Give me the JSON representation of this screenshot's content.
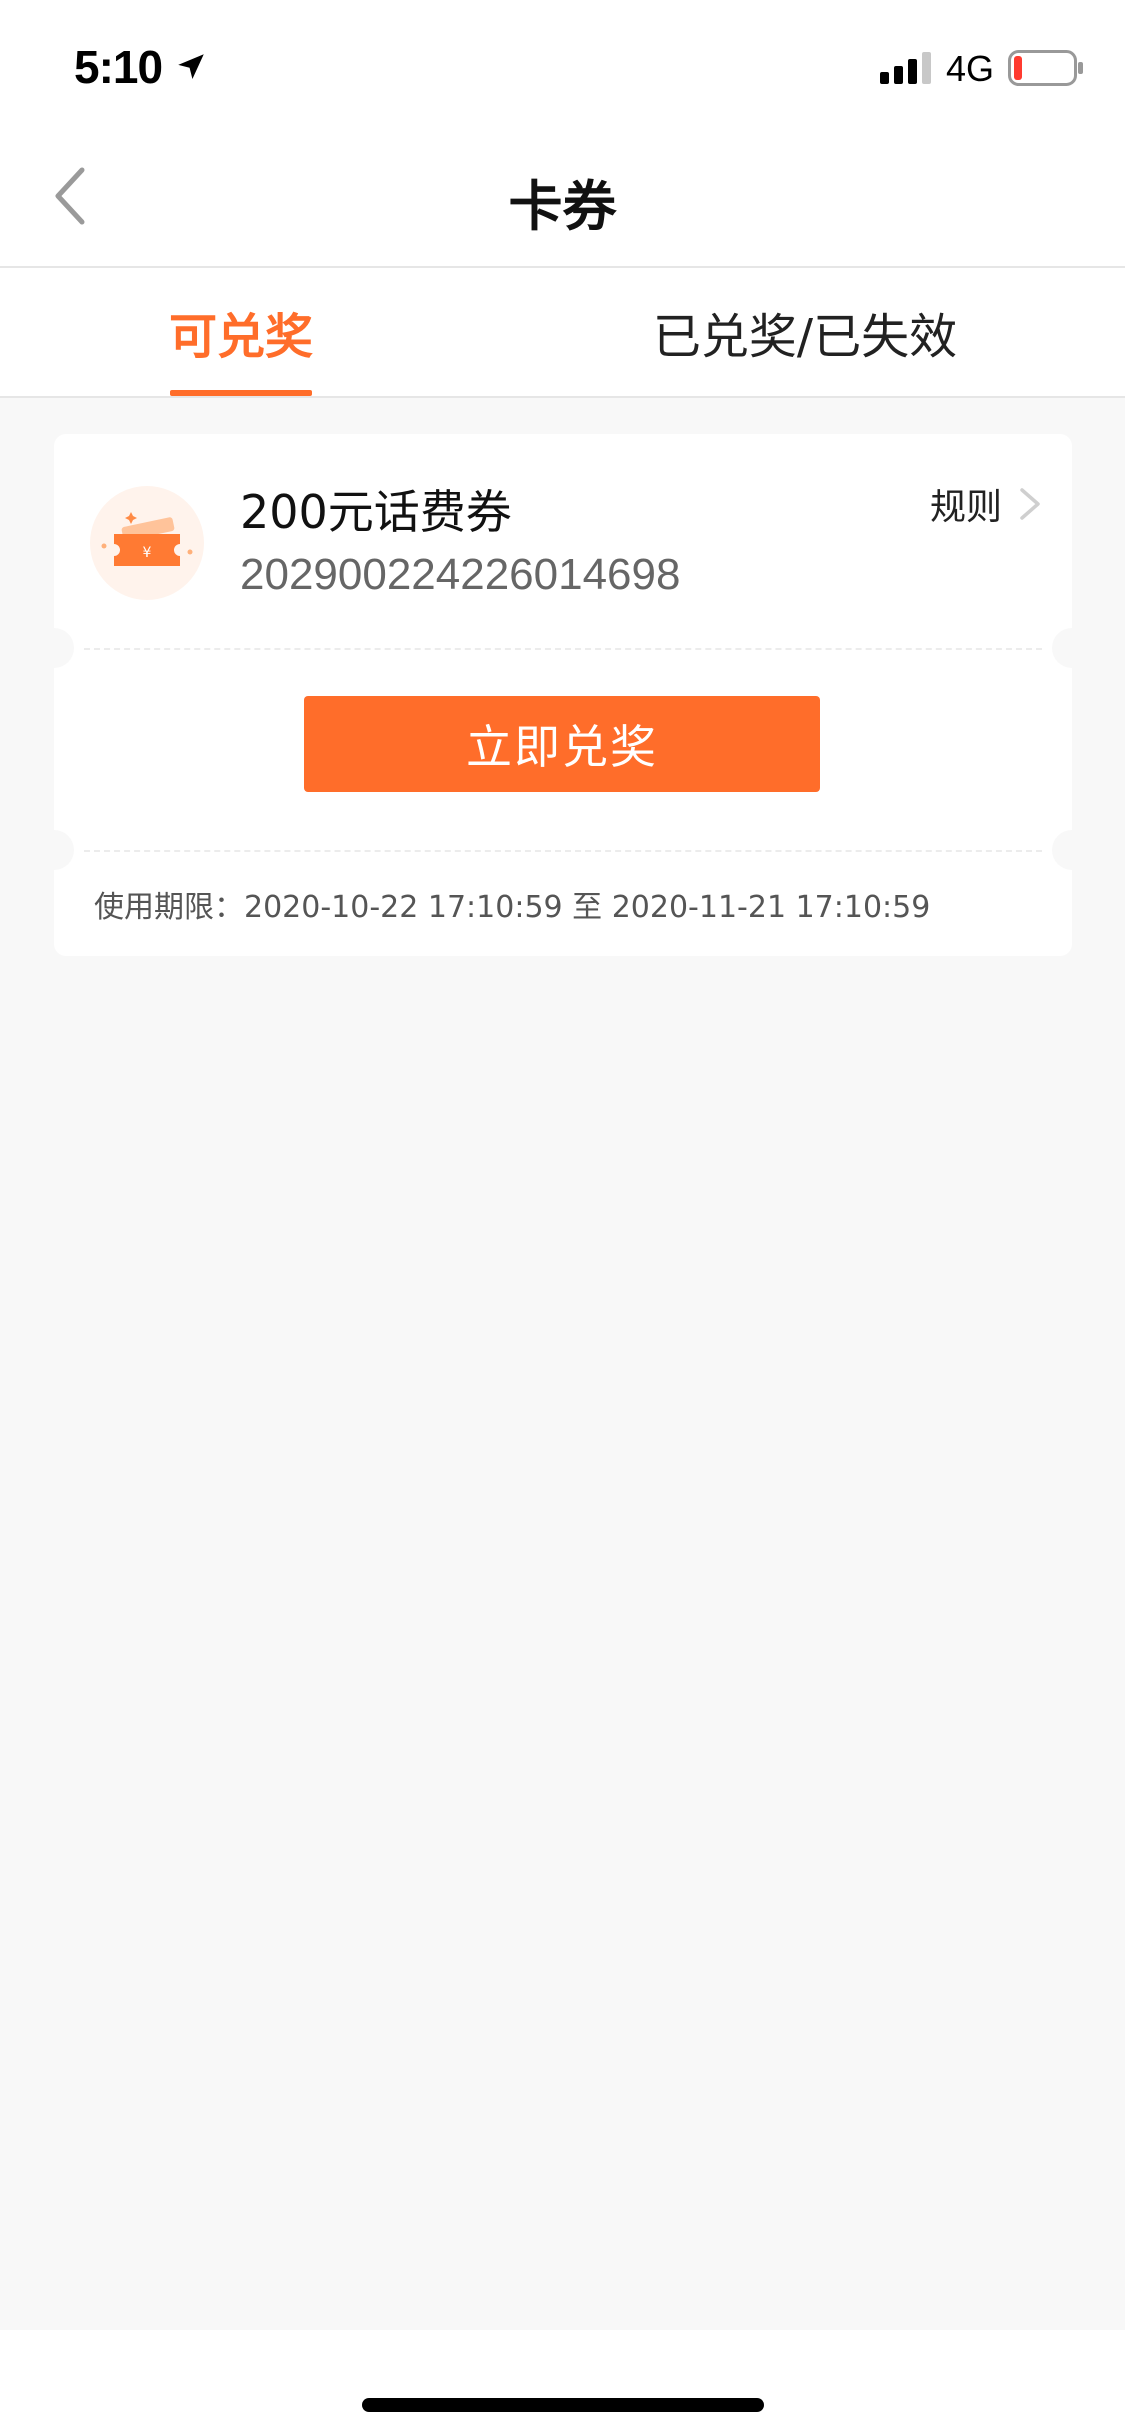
{
  "status_bar": {
    "time": "5:10",
    "network": "4G",
    "icons": [
      "location-arrow-icon",
      "signal-bars-icon",
      "battery-low-icon"
    ]
  },
  "nav": {
    "title": "卡券",
    "back_icon": "chevron-left-icon"
  },
  "tabs": [
    {
      "label": "可兑奖",
      "active": true
    },
    {
      "label": "已兑奖/已失效",
      "active": false
    }
  ],
  "coupon": {
    "name": "200元话费券",
    "code": "2029002242260146​98",
    "rules_label": "规则",
    "redeem_label": "立即兑奖",
    "validity": "使用期限：2020-10-22 17:10:59 至 2020-11-21 17:10:59",
    "icon": "ticket-yuan-icon"
  },
  "colors": {
    "accent": "#ff6d2a",
    "background": "#f8f8f8",
    "surface": "#ffffff"
  }
}
